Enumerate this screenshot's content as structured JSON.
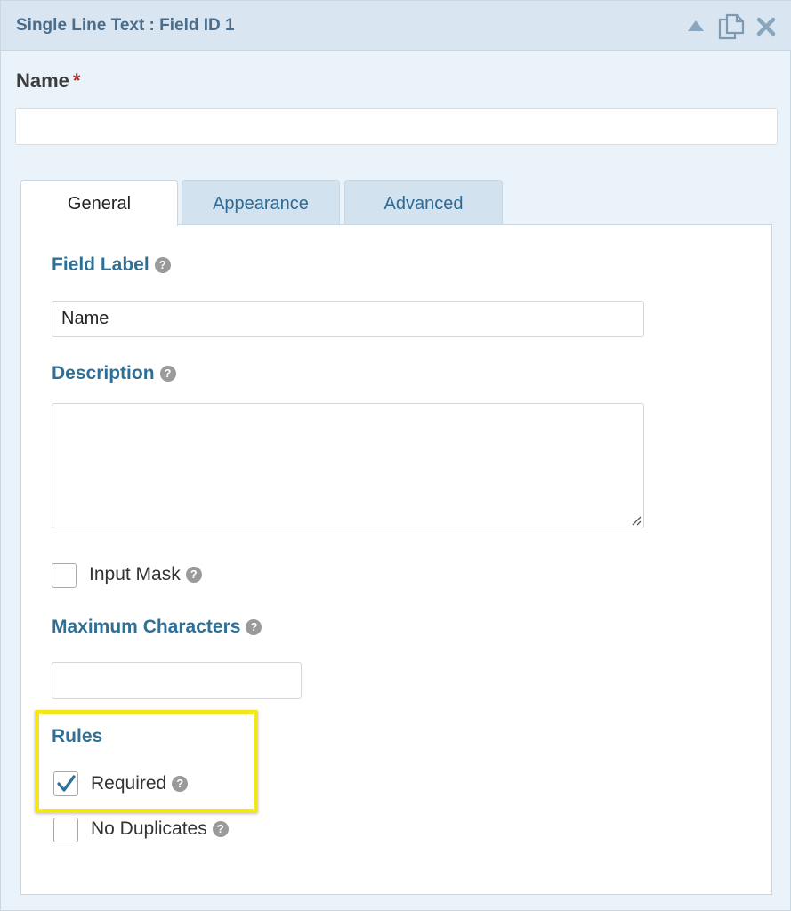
{
  "titlebar": {
    "title": "Single Line Text : Field ID 1",
    "icons": [
      "collapse-arrow-icon",
      "duplicate-icon",
      "close-icon"
    ]
  },
  "preview": {
    "label": "Name",
    "required_marker": "*"
  },
  "tabs": [
    {
      "label": "General",
      "active": true
    },
    {
      "label": "Appearance",
      "active": false
    },
    {
      "label": "Advanced",
      "active": false
    }
  ],
  "general": {
    "field_label": {
      "label": "Field Label",
      "value": "Name"
    },
    "description": {
      "label": "Description",
      "value": ""
    },
    "input_mask": {
      "label": "Input Mask",
      "checked": false
    },
    "maximum_characters": {
      "label": "Maximum Characters",
      "value": ""
    },
    "rules": {
      "label": "Rules",
      "required": {
        "label": "Required",
        "checked": true
      },
      "no_duplicates": {
        "label": "No Duplicates",
        "checked": false
      }
    }
  },
  "help_glyph": "?",
  "colors": {
    "accent": "#2e6f96",
    "highlight": "#f5e51b",
    "required": "#b32d2e"
  }
}
